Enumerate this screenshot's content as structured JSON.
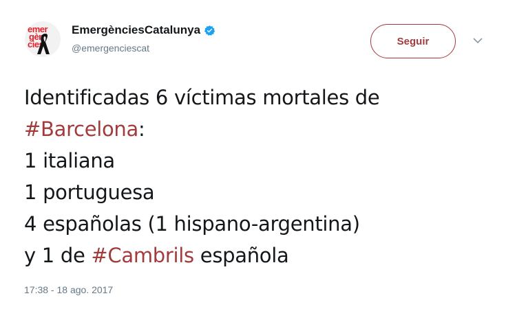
{
  "account": {
    "display_name": "EmergènciesCatalunya",
    "handle": "@emergenciescat",
    "verified": true,
    "avatar_lines": [
      "emer",
      "gèn",
      "cies"
    ]
  },
  "actions": {
    "follow_label": "Seguir"
  },
  "tweet": {
    "line1": "Identificadas 6 víctimas mortales de",
    "line2_hashtag": "#Barcelona",
    "line2_rest": ":",
    "line3": "1 italiana",
    "line4": "1 portuguesa",
    "line5": "4 españolas (1 hispano-argentina)",
    "line6_pre": "y 1 de ",
    "line6_hashtag": "#Cambrils",
    "line6_post": " española"
  },
  "timestamp": "17:38 - 18 ago. 2017",
  "colors": {
    "brand": "#a23b3b",
    "text": "#14171a",
    "secondary": "#657786",
    "verified": "#1da1f2"
  },
  "icons": {
    "verified": "verified-badge-icon",
    "caret": "chevron-down-icon",
    "mourning": "black-ribbon-icon"
  }
}
